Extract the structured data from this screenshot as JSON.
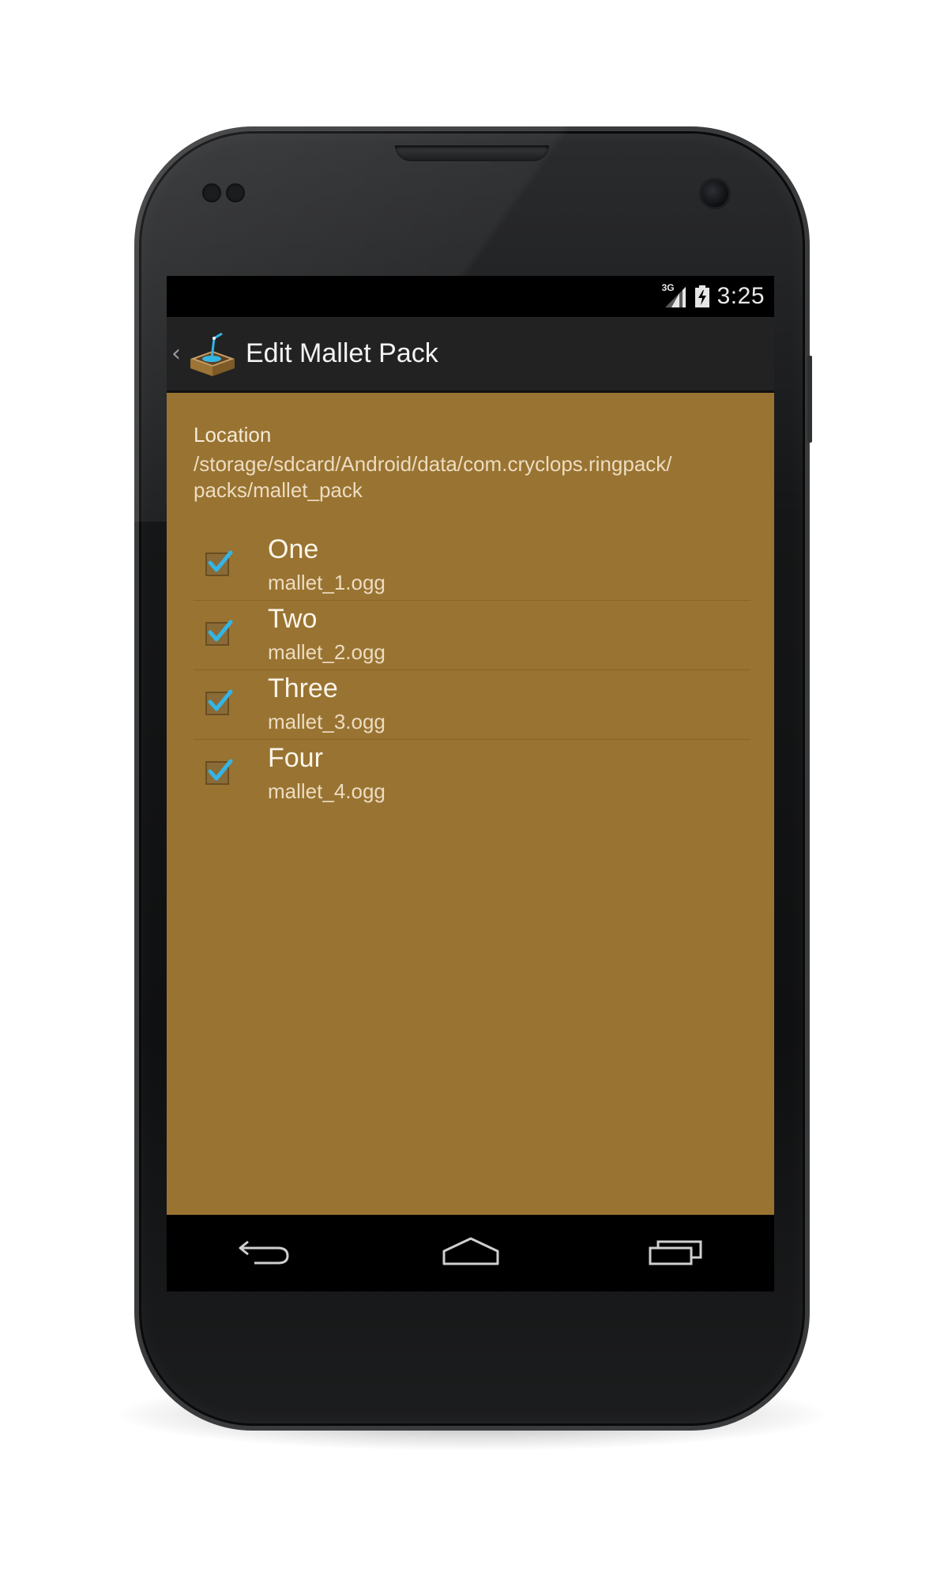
{
  "status_bar": {
    "network": "3G",
    "time": "3:25",
    "icons": [
      "signal-icon",
      "battery-charging-icon"
    ]
  },
  "action_bar": {
    "title": "Edit Mallet Pack",
    "icon": "app-box-icon",
    "up_icon": "chevron-left-icon"
  },
  "location": {
    "label": "Location",
    "path_line1": "/storage/sdcard/Android/data/com.cryclops.ringpack/",
    "path_line2": "packs/mallet_pack"
  },
  "items": [
    {
      "title": "One",
      "file": "mallet_1.ogg",
      "checked": true
    },
    {
      "title": "Two",
      "file": "mallet_2.ogg",
      "checked": true
    },
    {
      "title": "Three",
      "file": "mallet_3.ogg",
      "checked": true
    },
    {
      "title": "Four",
      "file": "mallet_4.ogg",
      "checked": true
    }
  ],
  "nav_bar": {
    "icons": [
      "back-icon",
      "home-icon",
      "recents-icon"
    ]
  },
  "colors": {
    "content_bg": "#997331",
    "check_accent": "#33b5e5",
    "action_bar_bg": "#222223"
  }
}
